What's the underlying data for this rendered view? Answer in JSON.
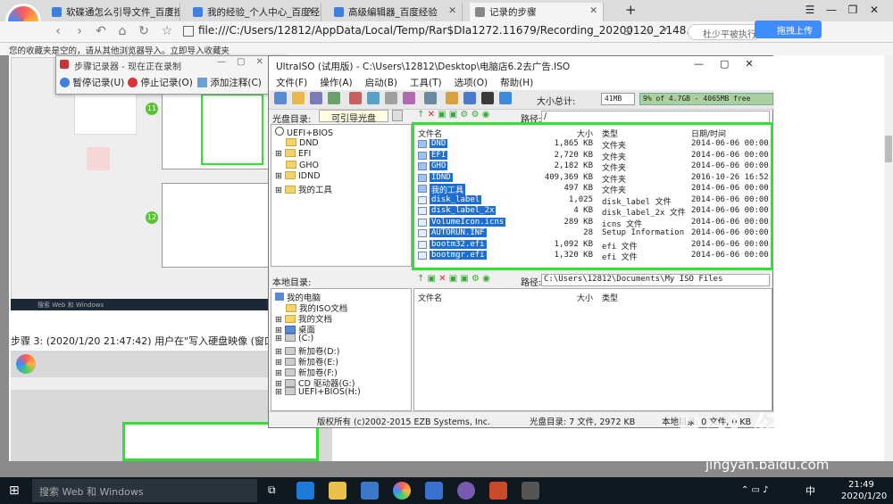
{
  "browser": {
    "tabs": [
      {
        "label": "软碟通怎么引导文件_百度搜索"
      },
      {
        "label": "我的经验_个人中心_百度经验"
      },
      {
        "label": "高级编辑器_百度经验"
      },
      {
        "label": "记录的步骤"
      }
    ],
    "new_tab": "+",
    "url": "file:///C:/Users/12812/AppData/Local/Temp/Rar$DIa1272.11679/Recording_20200120_2148.m",
    "search_text": "杜少平被执行",
    "blue_button": "拖拽上传",
    "favbar": "您的收藏夹是空的，请从其他浏览器导入。立即导入收藏夹",
    "window_buttons": [
      "☰",
      "—",
      "❐",
      "✕"
    ]
  },
  "recorder": {
    "title": "步骤记录器 - 现在正在录制",
    "pause": "暂停记录(U)",
    "stop": "停止记录(O)",
    "comment": "添加注释(C)"
  },
  "uiso": {
    "title": "UltraISO (试用版) - C:\\Users\\12812\\Desktop\\电脑店6.2去广告.ISO",
    "menu": [
      "文件(F)",
      "操作(A)",
      "启动(B)",
      "工具(T)",
      "选项(O)",
      "帮助(H)"
    ],
    "total_label": "大小总计:",
    "total_value": "41MB",
    "capacity": "9% of 4.7GB - 4065MB free",
    "disc_dir_label": "光盘目录:",
    "disc_type": "可引导光盘",
    "path_label": "路径:",
    "disc_path": "/",
    "disc_tree": [
      "UEFI+BIOS",
      "DND",
      "EFI",
      "GHO",
      "IDND",
      "我的工具"
    ],
    "columns": [
      "文件名",
      "大小",
      "类型",
      "日期/时间"
    ],
    "files": [
      {
        "name": "DND",
        "size": "1,865 KB",
        "type": "文件夹",
        "date": "2014-06-06 00:00"
      },
      {
        "name": "EFI",
        "size": "2,720 KB",
        "type": "文件夹",
        "date": "2014-06-06 00:00"
      },
      {
        "name": "GHO",
        "size": "2,182 KB",
        "type": "文件夹",
        "date": "2014-06-06 00:00"
      },
      {
        "name": "IDND",
        "size": "409,369 KB",
        "type": "文件夹",
        "date": "2016-10-26 16:52"
      },
      {
        "name": "我的工具",
        "size": "497 KB",
        "type": "文件夹",
        "date": "2014-06-06 00:00"
      },
      {
        "name": "disk_label",
        "size": "1,025",
        "type": "disk_label 文件",
        "date": "2014-06-06 00:00"
      },
      {
        "name": "disk_label_2x",
        "size": "4 KB",
        "type": "disk_label_2x 文件",
        "date": "2014-06-06 00:00"
      },
      {
        "name": "VolumeIcon.icns",
        "size": "289 KB",
        "type": "icns 文件",
        "date": "2014-06-06 00:00"
      },
      {
        "name": "AUTORUN.INF",
        "size": "28",
        "type": "Setup Information",
        "date": "2014-06-06 00:00"
      },
      {
        "name": "bootm32.efi",
        "size": "1,092 KB",
        "type": "efi 文件",
        "date": "2014-06-06 00:00"
      },
      {
        "name": "bootmgr.efi",
        "size": "1,320 KB",
        "type": "efi 文件",
        "date": "2014-06-06 00:00"
      }
    ],
    "local_dir_label": "本地目录:",
    "local_path": "C:\\Users\\12812\\Documents\\My ISO Files",
    "local_tree": [
      "我的电脑",
      "我的ISO文档",
      "我的文档",
      "桌面",
      "(C:)",
      "新加卷(D:)",
      "新加卷(E:)",
      "新加卷(F:)",
      "CD 驱动器(G:)",
      "UEFI+BIOS(H:)"
    ],
    "local_columns": [
      "文件名",
      "大小",
      "类型"
    ],
    "status_copyright": "版权所有 (c)2002-2015 EZB Systems, Inc.",
    "status_disc": "光盘目录: 7 文件, 2972 KB",
    "status_local": "本地目录: 0 文件, 0 KB"
  },
  "page": {
    "step3": "步骤 3: (2020/1/20 21:47:42) 用户在\"写入硬盘映像 (窗口)\"上",
    "num11": "11",
    "num12": "12",
    "thumb_taskbar": "搜索 Web 和 Windows"
  },
  "watermark": {
    "brand": "Bai 经验",
    "url": "jingyan.baidu.com"
  },
  "taskbar": {
    "search": "搜索 Web 和 Windows",
    "time": "21:49",
    "date": "2020/1/20",
    "ime": "中"
  },
  "colors": {
    "accent": "#3f8cff",
    "green_frame": "#32e032",
    "selection": "#1e6ed4"
  }
}
